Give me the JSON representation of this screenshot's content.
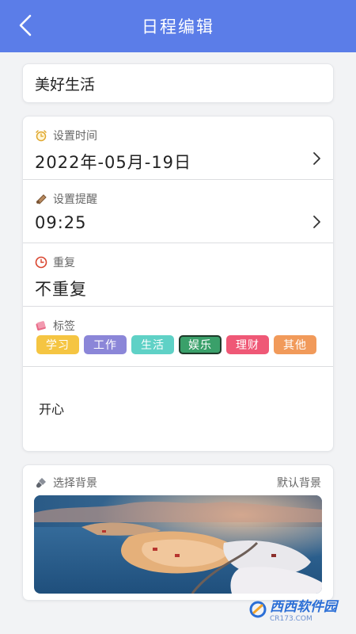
{
  "header": {
    "title": "日程编辑",
    "back_icon": "chevron-left-icon"
  },
  "title_field": {
    "value": "美好生活"
  },
  "time": {
    "label": "设置时间",
    "value": "2022年-05月-19日",
    "icon": "alarm-clock-icon"
  },
  "reminder": {
    "label": "设置提醒",
    "value": "09:25",
    "icon": "bell-icon"
  },
  "repeat": {
    "label": "重复",
    "value": "不重复",
    "icon": "clock-icon"
  },
  "tags": {
    "label": "标签",
    "icon": "tag-icon",
    "items": [
      {
        "label": "学习",
        "color": "#f5c542"
      },
      {
        "label": "工作",
        "color": "#8b86d8"
      },
      {
        "label": "生活",
        "color": "#5fd1c6"
      },
      {
        "label": "娱乐",
        "color": "#3aa06a",
        "selected": true
      },
      {
        "label": "理财",
        "color": "#ef5876"
      },
      {
        "label": "其他",
        "color": "#f19a5a"
      }
    ]
  },
  "note": {
    "value": "开心"
  },
  "background": {
    "label": "选择背景",
    "default_label": "默认背景",
    "icon": "brush-icon"
  },
  "colors": {
    "accent": "#5b7de8"
  }
}
